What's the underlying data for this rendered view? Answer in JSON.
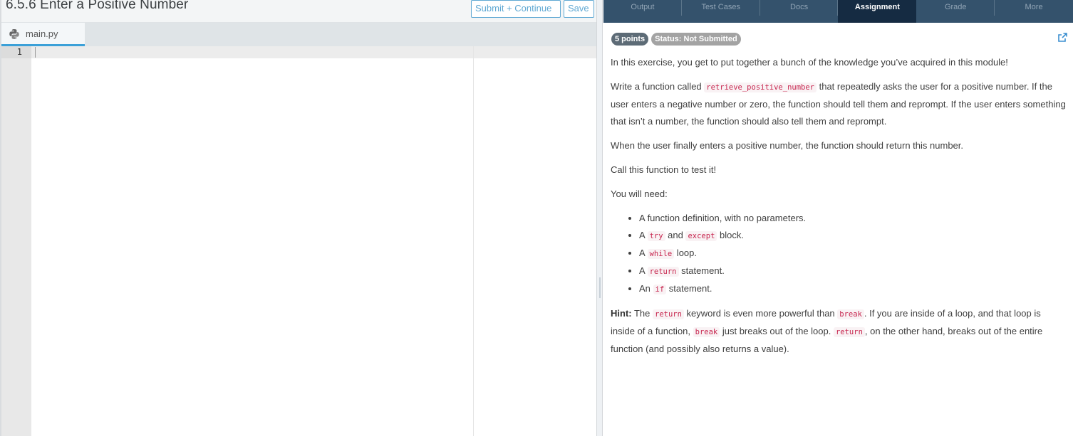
{
  "editor": {
    "title": "6.5.6 Enter a Positive Number",
    "buttons": {
      "submit_continue": "Submit + Continue",
      "save": "Save"
    },
    "file_tab": {
      "name": "main.py",
      "icon": "python-icon"
    },
    "line_numbers": [
      "1"
    ],
    "code": ""
  },
  "panel": {
    "tabs": [
      {
        "label": "Output",
        "active": false
      },
      {
        "label": "Test Cases",
        "active": false
      },
      {
        "label": "Docs",
        "active": false
      },
      {
        "label": "Assignment",
        "active": true
      },
      {
        "label": "Grade",
        "active": false
      },
      {
        "label": "More",
        "active": false
      }
    ],
    "badges": {
      "points": "5 points",
      "status": "Status: Not Submitted"
    },
    "external_link_icon": "external-link-icon",
    "assignment": {
      "intro": "In this exercise, you get to put together a bunch of the knowledge you’ve acquired in this module!",
      "p2_before": "Write a function called ",
      "p2_code": "retrieve_positive_number",
      "p2_after": " that repeatedly asks the user for a positive number. If the user enters a negative number or zero, the function should tell them and reprompt. If the user enters something that isn’t a number, the function should also tell them and reprompt.",
      "p3": "When the user finally enters a positive number, the function should return this number.",
      "p4": "Call this function to test it!",
      "p5": "You will need:",
      "needs": [
        {
          "pre": "A function definition, with no parameters.",
          "code1": "",
          "mid": "",
          "code2": "",
          "post": ""
        },
        {
          "pre": "A ",
          "code1": "try",
          "mid": " and ",
          "code2": "except",
          "post": " block."
        },
        {
          "pre": "A ",
          "code1": "while",
          "mid": " loop.",
          "code2": "",
          "post": ""
        },
        {
          "pre": "A ",
          "code1": "return",
          "mid": " statement.",
          "code2": "",
          "post": ""
        },
        {
          "pre": "An ",
          "code1": "if",
          "mid": " statement.",
          "code2": "",
          "post": ""
        }
      ],
      "hint": {
        "label": "Hint:",
        "t1": " The ",
        "c1": "return",
        "t2": " keyword is even more powerful than ",
        "c2": "break",
        "t3": ". If you are inside of a loop, and that loop is inside of a function, ",
        "c3": "break",
        "t4": " just breaks out of the loop. ",
        "c4": "return",
        "t5": ", on the other hand, breaks out of the entire function (and possibly also returns a value)."
      }
    }
  },
  "colors": {
    "accent": "#3ba0d8",
    "button_border": "#5fa8d3",
    "nav_bg": "#34526c",
    "nav_active": "#152b42",
    "code_text": "#c7254e"
  }
}
